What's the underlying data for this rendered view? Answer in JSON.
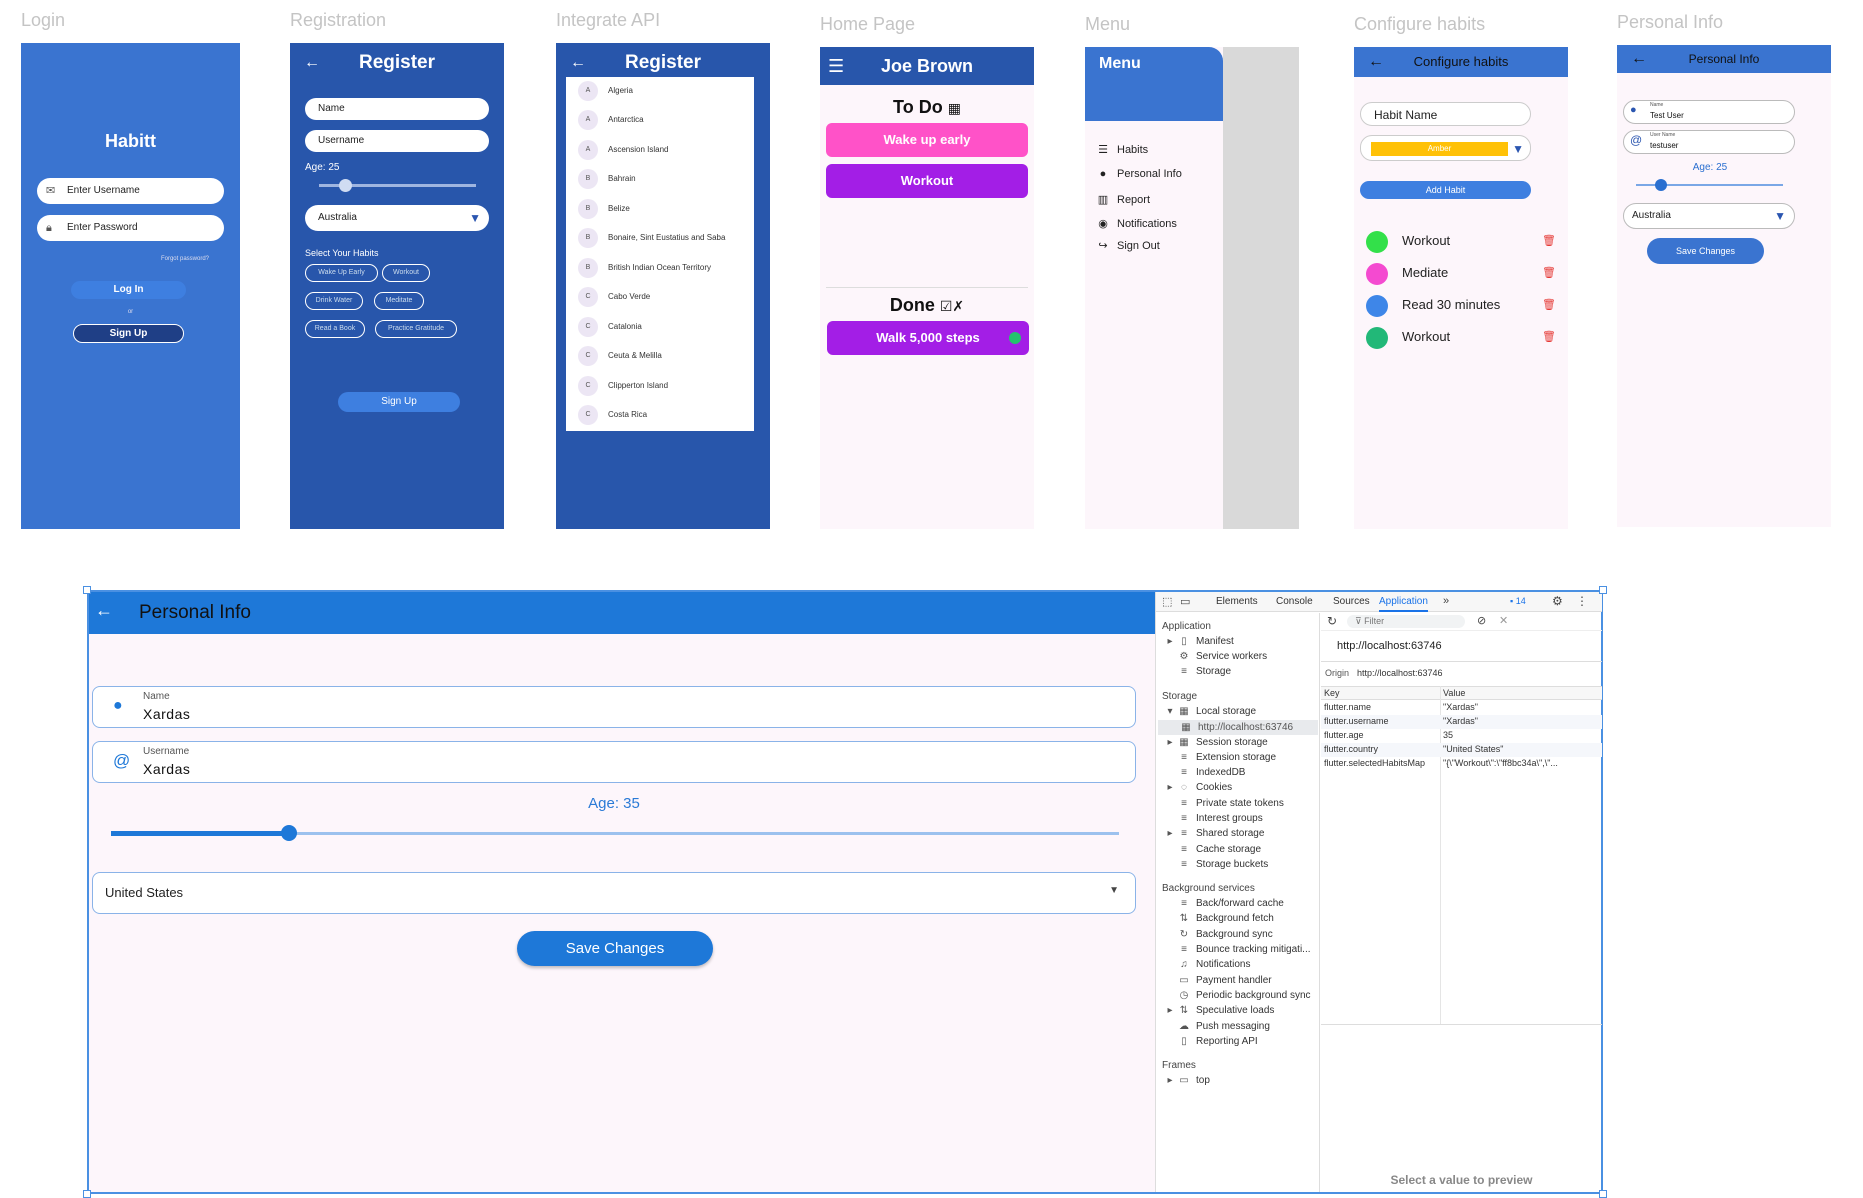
{
  "frames": {
    "login_title": "Login",
    "registration_title": "Registration",
    "api_title": "Integrate API",
    "home_title": "Home Page",
    "menu_title": "Menu",
    "habits_title": "Configure habits",
    "personal_title": "Personal Info"
  },
  "login": {
    "app_name": "Habitt",
    "username_placeholder": "Enter Username",
    "password_placeholder": "Enter Password",
    "forgot": "Forgot password?",
    "login_label": "Log In",
    "or": "or",
    "signup_label": "Sign Up"
  },
  "registration": {
    "header": "Register",
    "back": "←",
    "name_placeholder": "Name",
    "username_placeholder": "Username",
    "age_label": "Age: 25",
    "age_value": 0.17,
    "country": "Australia",
    "habits_label": "Select Your Habits",
    "habits": [
      "Wake Up Early",
      "Workout",
      "Drink Water",
      "Meditate",
      "Read a Book",
      "Practice Gratitude"
    ],
    "signup_label": "Sign Up"
  },
  "api": {
    "header": "Register",
    "back": "←",
    "countries": [
      {
        "letter": "A",
        "name": "Algeria"
      },
      {
        "letter": "A",
        "name": "Antarctica"
      },
      {
        "letter": "A",
        "name": "Ascension Island"
      },
      {
        "letter": "B",
        "name": "Bahrain"
      },
      {
        "letter": "B",
        "name": "Belize"
      },
      {
        "letter": "B",
        "name": "Bonaire, Sint Eustatius and Saba"
      },
      {
        "letter": "B",
        "name": "British Indian Ocean Territory"
      },
      {
        "letter": "C",
        "name": "Cabo Verde"
      },
      {
        "letter": "C",
        "name": "Catalonia"
      },
      {
        "letter": "C",
        "name": "Ceuta & Melilla"
      },
      {
        "letter": "C",
        "name": "Clipperton Island"
      },
      {
        "letter": "C",
        "name": "Costa Rica"
      }
    ]
  },
  "home": {
    "user": "Joe Brown",
    "todo_label": "To Do",
    "todo": [
      {
        "label": "Wake up early",
        "color": "#ff52c8"
      },
      {
        "label": "Workout",
        "color": "#a31ee6"
      }
    ],
    "done_label": "Done",
    "done": [
      {
        "label": "Walk 5,000 steps",
        "color": "#a31ee6"
      }
    ]
  },
  "menu": {
    "title": "Menu",
    "items": [
      {
        "icon": "list-icon",
        "label": "Habits"
      },
      {
        "icon": "person-icon",
        "label": "Personal Info"
      },
      {
        "icon": "chart-icon",
        "label": "Report"
      },
      {
        "icon": "bell-icon",
        "label": "Notifications"
      },
      {
        "icon": "logout-icon",
        "label": "Sign Out"
      }
    ]
  },
  "configure": {
    "header": "Configure habits",
    "back": "←",
    "habit_name_placeholder": "Habit Name",
    "color_value": "Amber",
    "add_label": "Add Habit",
    "habits": [
      {
        "label": "Workout",
        "color": "#33e04a"
      },
      {
        "label": "Mediate",
        "color": "#f44ad0"
      },
      {
        "label": "Read 30 minutes",
        "color": "#3e86e8"
      },
      {
        "label": "Workout",
        "color": "#22b878"
      }
    ]
  },
  "personal_small": {
    "header": "Personal Info",
    "back": "←",
    "name_label": "Name",
    "name_value": "Test User",
    "username_label": "User Name",
    "username_value": "testuser",
    "age_label": "Age: 25",
    "age_value": 0.17,
    "country": "Australia",
    "save_label": "Save Changes"
  },
  "app": {
    "back": "←",
    "header": "Personal Info",
    "name_label": "Name",
    "name_value": "Xardas",
    "username_label": "Username",
    "username_value": "Xardas",
    "age_label": "Age: 35",
    "age_value": 0.177,
    "country": "United States",
    "save_label": "Save Changes"
  },
  "devtools": {
    "tabs": [
      "Elements",
      "Console",
      "Sources",
      "Application"
    ],
    "active_tab": "Application",
    "issues_count": "14",
    "filter_placeholder": "Filter",
    "sections": {
      "application": "Application",
      "storage": "Storage",
      "background": "Background services",
      "frames": "Frames"
    },
    "app_items": [
      "Manifest",
      "Service workers",
      "Storage"
    ],
    "storage_items": [
      "Local storage",
      "http://localhost:63746",
      "Session storage",
      "Extension storage",
      "IndexedDB",
      "Cookies",
      "Private state tokens",
      "Interest groups",
      "Shared storage",
      "Cache storage",
      "Storage buckets"
    ],
    "background_items": [
      "Back/forward cache",
      "Background fetch",
      "Background sync",
      "Bounce tracking mitigati...",
      "Notifications",
      "Payment handler",
      "Periodic background sync",
      "Speculative loads",
      "Push messaging",
      "Reporting API"
    ],
    "frames_items": [
      "top"
    ],
    "origin_title": "http://localhost:63746",
    "origin_label": "Origin",
    "origin_value": "http://localhost:63746",
    "key_header": "Key",
    "value_header": "Value",
    "rows": [
      {
        "key": "flutter.name",
        "value": "\"Xardas\""
      },
      {
        "key": "flutter.username",
        "value": "\"Xardas\""
      },
      {
        "key": "flutter.age",
        "value": "35"
      },
      {
        "key": "flutter.country",
        "value": "\"United States\""
      },
      {
        "key": "flutter.selectedHabitsMap",
        "value": "\"{\\\"Workout\\\":\\\"ff8bc34a\\\",\\\"..."
      }
    ],
    "preview_hint": "Select a value to preview"
  }
}
